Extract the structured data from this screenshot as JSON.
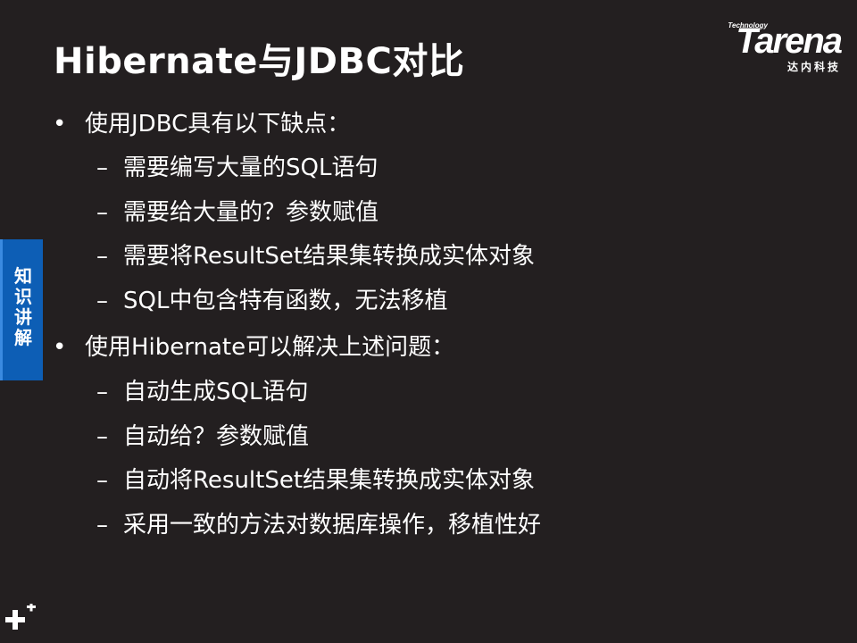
{
  "title": "Hibernate与JDBC对比",
  "logo": {
    "tech": "Technology",
    "word": "Tarena",
    "cn": "达内科技"
  },
  "side_tab": "知识讲解",
  "bullets": [
    {
      "marker": "•",
      "text": "使用JDBC具有以下缺点：",
      "subs": [
        {
          "marker": "–",
          "text": "需要编写大量的SQL语句"
        },
        {
          "marker": "–",
          "text": "需要给大量的？参数赋值"
        },
        {
          "marker": "–",
          "text": "需要将ResultSet结果集转换成实体对象"
        },
        {
          "marker": "–",
          "text": "SQL中包含特有函数，无法移植"
        }
      ]
    },
    {
      "marker": "•",
      "text": "使用Hibernate可以解决上述问题：",
      "subs": [
        {
          "marker": "–",
          "text": "自动生成SQL语句"
        },
        {
          "marker": "–",
          "text": "自动给？参数赋值"
        },
        {
          "marker": "–",
          "text": "自动将ResultSet结果集转换成实体对象"
        },
        {
          "marker": "–",
          "text": "采用一致的方法对数据库操作，移植性好"
        }
      ]
    }
  ],
  "icons": {
    "corner": "plus-icon"
  }
}
